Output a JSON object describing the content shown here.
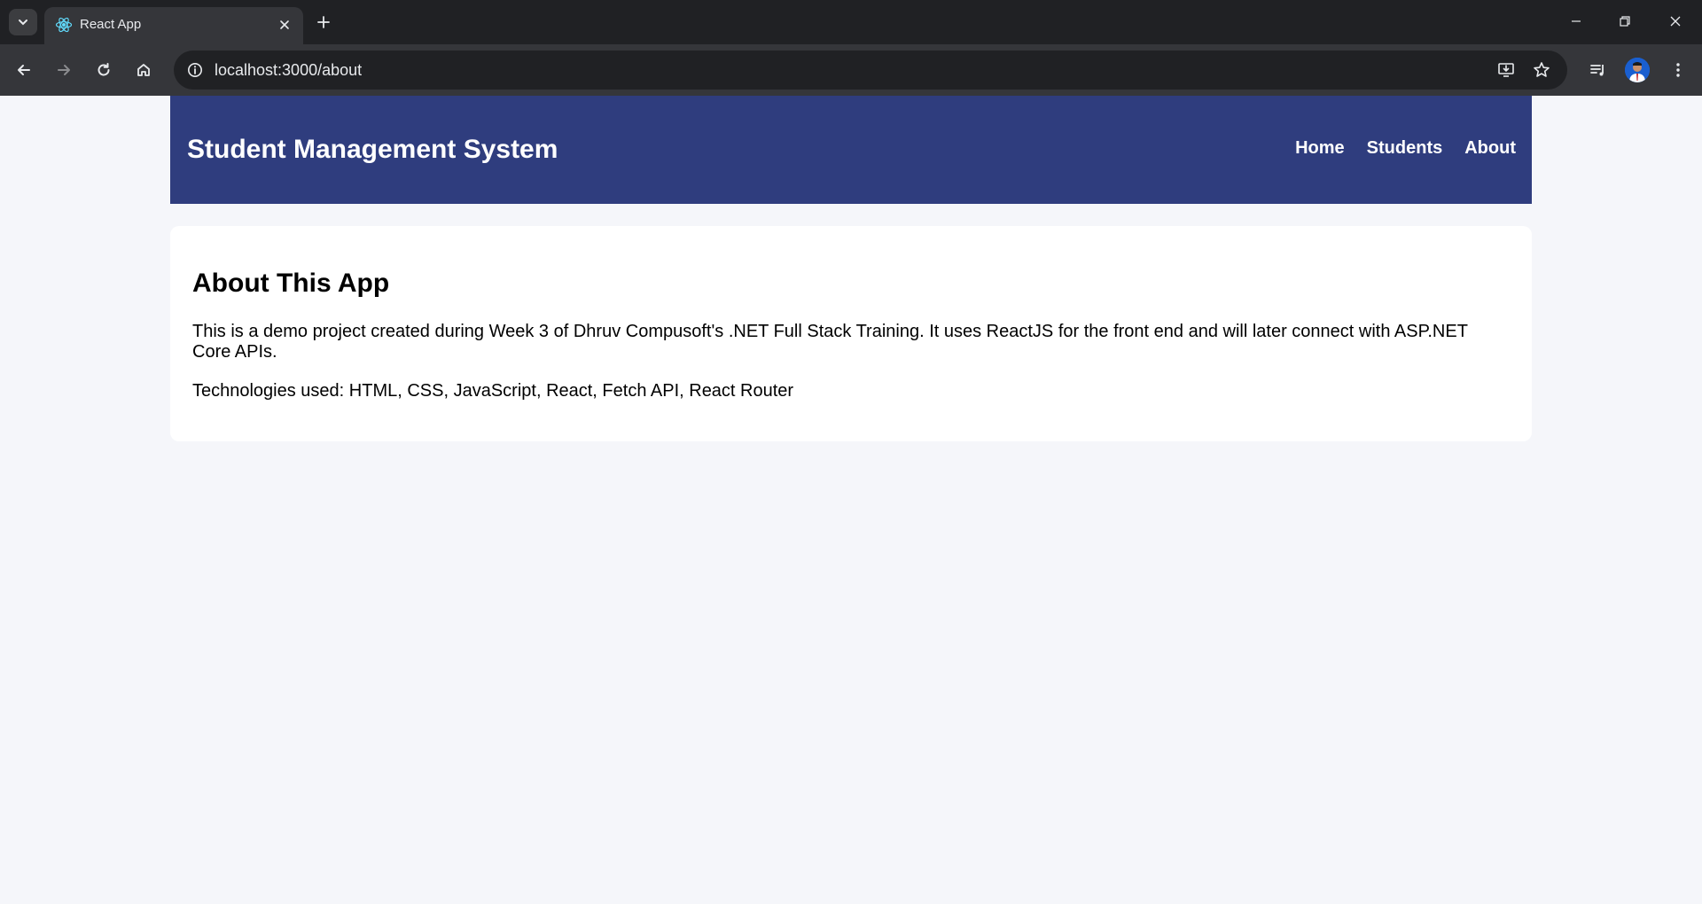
{
  "browser": {
    "tab": {
      "title": "React App"
    },
    "address_bar": {
      "url": "localhost:3000/about"
    },
    "icons": {
      "tab_search": "chevron-down-icon",
      "favicon": "react-logo-icon",
      "close_tab": "close-icon",
      "new_tab": "plus-icon",
      "back": "arrow-left-icon",
      "forward": "arrow-right-icon",
      "reload": "reload-icon",
      "home": "home-icon",
      "site_info": "info-icon",
      "install": "install-app-icon",
      "bookmark": "star-icon",
      "media": "media-queue-icon",
      "profile": "avatar",
      "menu": "kebab-menu-icon"
    }
  },
  "app": {
    "brand": "Student Management System",
    "nav": {
      "home": "Home",
      "students": "Students",
      "about": "About"
    },
    "about": {
      "title": "About This App",
      "description": "This is a demo project created during Week 3 of Dhruv Compusoft's .NET Full Stack Training. It uses ReactJS for the front end and will later connect with ASP.NET Core APIs.",
      "technologies": "Technologies used: HTML, CSS, JavaScript, React, Fetch API, React Router"
    }
  },
  "colors": {
    "navbar": "#2f3d7e",
    "page_bg": "#f5f6fa",
    "card_bg": "#ffffff",
    "chrome_dark": "#202124",
    "chrome_toolbar": "#35363a"
  }
}
